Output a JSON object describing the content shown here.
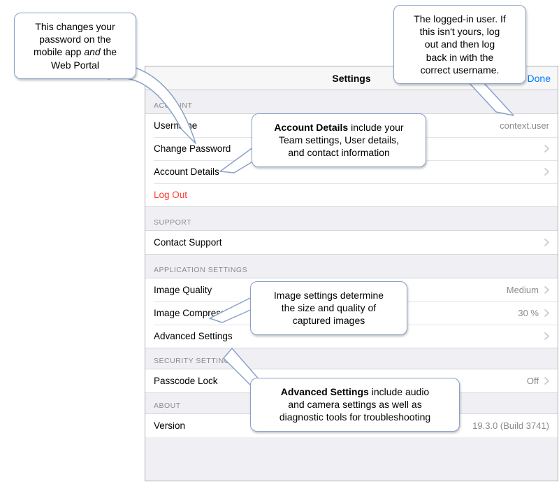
{
  "nav": {
    "title": "Settings",
    "done": "Done"
  },
  "sections": {
    "account": {
      "header": "ACCOUNT",
      "username_label": "Username",
      "username_value": "context.user",
      "change_password": "Change Password",
      "account_details": "Account Details",
      "log_out": "Log Out"
    },
    "support": {
      "header": "SUPPORT",
      "contact": "Contact Support"
    },
    "app": {
      "header": "APPLICATION SETTINGS",
      "image_quality_label": "Image Quality",
      "image_quality_value": "Medium",
      "image_compression_label": "Image Compression",
      "image_compression_value": "30 %",
      "advanced": "Advanced Settings"
    },
    "security": {
      "header": "SECURITY SETTINGS",
      "passcode_label": "Passcode Lock",
      "passcode_value": "Off"
    },
    "about": {
      "header": "ABOUT",
      "version_label": "Version",
      "version_value": "19.3.0 (Build 3741)"
    }
  },
  "callouts": {
    "password": {
      "l1": "This changes your",
      "l2": "password on the",
      "l3_a": "mobile app ",
      "l3_em": "and",
      "l3_b": " the",
      "l4": "Web Portal"
    },
    "user": {
      "l1": "The logged-in user. If",
      "l2": "this isn't yours, log",
      "l3": "out and then log",
      "l4": "back in with the",
      "l5": "correct username."
    },
    "account_details": {
      "l1_b": "Account Details",
      "l1_r": " include your",
      "l2": "Team settings, User details,",
      "l3": "and contact information"
    },
    "image": {
      "l1": "Image settings determine",
      "l2": "the size and quality of",
      "l3": "captured images"
    },
    "advanced": {
      "l1_b": "Advanced Settings",
      "l1_r": " include audio",
      "l2": "and camera settings as well as",
      "l3": "diagnostic tools for troubleshooting"
    }
  }
}
